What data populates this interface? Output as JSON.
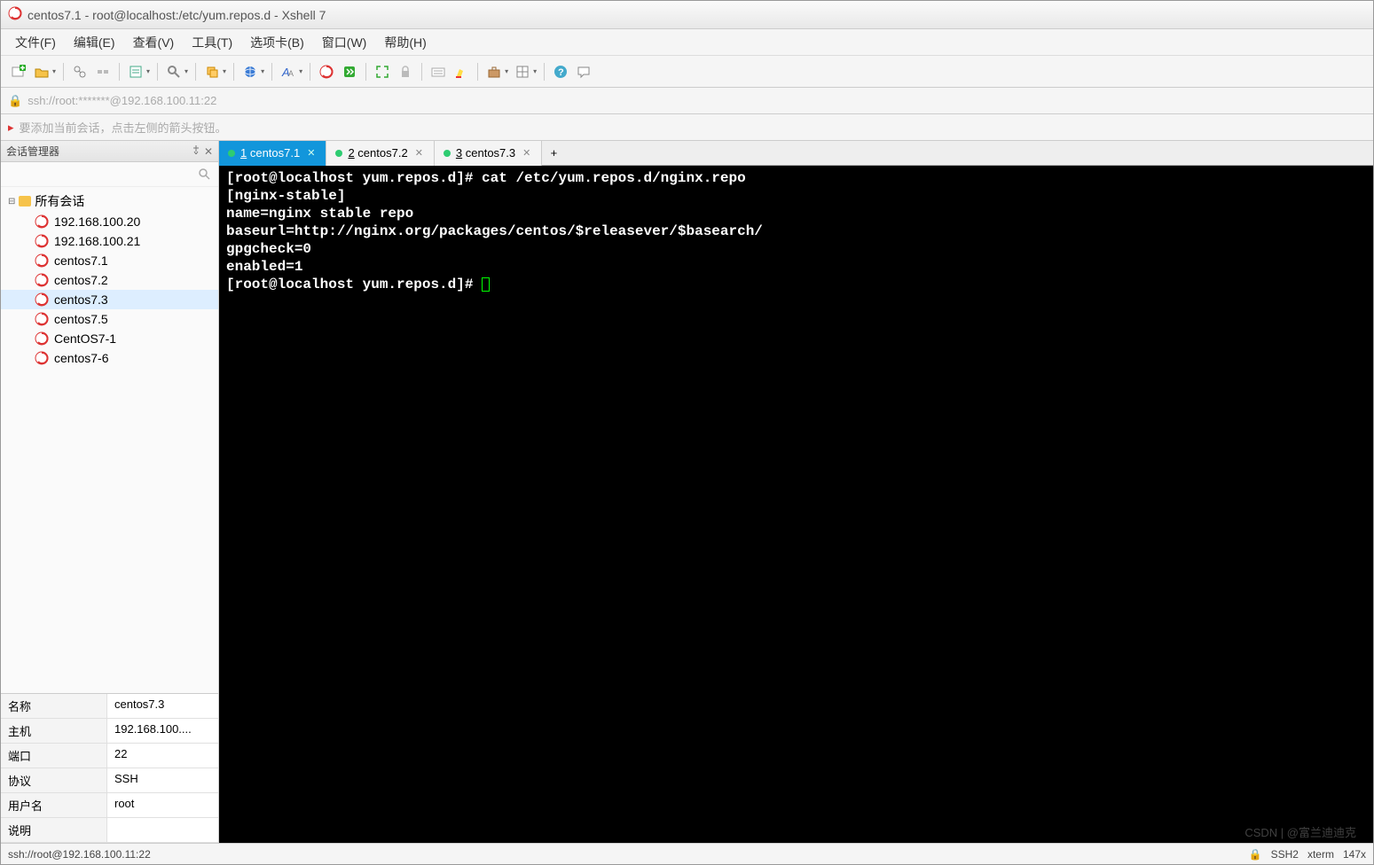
{
  "window": {
    "title": "centos7.1 - root@localhost:/etc/yum.repos.d - Xshell 7"
  },
  "menu": {
    "items": [
      "文件(F)",
      "编辑(E)",
      "查看(V)",
      "工具(T)",
      "选项卡(B)",
      "窗口(W)",
      "帮助(H)"
    ]
  },
  "address": {
    "url": "ssh://root:*******@192.168.100.11:22"
  },
  "hint": {
    "text": "要添加当前会话，点击左侧的箭头按钮。"
  },
  "sidebar": {
    "title": "会话管理器",
    "rootLabel": "所有会话",
    "sessions": [
      "192.168.100.20",
      "192.168.100.21",
      "centos7.1",
      "centos7.2",
      "centos7.3",
      "centos7.5",
      "CentOS7-1",
      "centos7-6"
    ],
    "props": {
      "nameKey": "名称",
      "nameVal": "centos7.3",
      "hostKey": "主机",
      "hostVal": "192.168.100....",
      "portKey": "端口",
      "portVal": "22",
      "protoKey": "协议",
      "protoVal": "SSH",
      "userKey": "用户名",
      "userVal": "root",
      "descKey": "说明",
      "descVal": ""
    }
  },
  "tabs": {
    "items": [
      {
        "num": "1",
        "label": "centos7.1",
        "active": true
      },
      {
        "num": "2",
        "label": "centos7.2",
        "active": false
      },
      {
        "num": "3",
        "label": "centos7.3",
        "active": false
      }
    ]
  },
  "terminal": {
    "lines": [
      "[root@localhost yum.repos.d]# cat /etc/yum.repos.d/nginx.repo",
      "[nginx-stable]",
      "name=nginx stable repo",
      "baseurl=http://nginx.org/packages/centos/$releasever/$basearch/",
      "gpgcheck=0",
      "enabled=1",
      "[root@localhost yum.repos.d]# "
    ]
  },
  "status": {
    "left": "ssh://root@192.168.100.11:22",
    "ssh": "SSH2",
    "term": "xterm",
    "cols": "147x"
  },
  "watermark": "CSDN | @富兰迪迪克"
}
